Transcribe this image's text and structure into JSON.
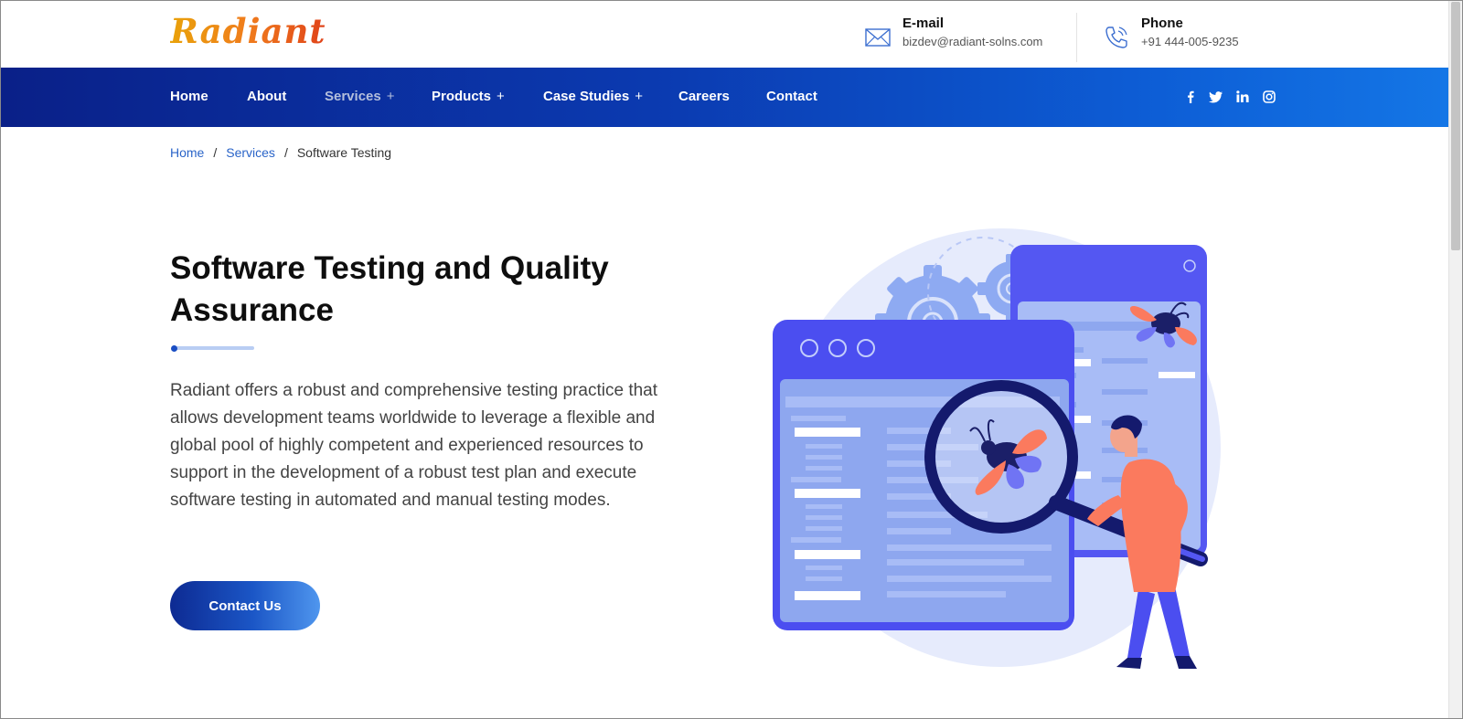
{
  "brand": {
    "logo_text": "Radiant"
  },
  "header_contacts": {
    "email": {
      "label": "E-mail",
      "value": "bizdev@radiant-solns.com",
      "icon": "envelope-icon"
    },
    "phone": {
      "label": "Phone",
      "value": "+91 444-005-9235",
      "icon": "phone-icon"
    }
  },
  "nav": {
    "items": [
      {
        "label": "Home",
        "has_submenu": false
      },
      {
        "label": "About",
        "has_submenu": false
      },
      {
        "label": "Services",
        "has_submenu": true,
        "active": true
      },
      {
        "label": "Products",
        "has_submenu": true
      },
      {
        "label": "Case Studies",
        "has_submenu": true
      },
      {
        "label": "Careers",
        "has_submenu": false
      },
      {
        "label": "Contact",
        "has_submenu": false
      }
    ],
    "submenu_symbol": "+",
    "social": [
      {
        "name": "facebook-icon",
        "glyph": "f"
      },
      {
        "name": "twitter-icon",
        "glyph": "t"
      },
      {
        "name": "linkedin-icon",
        "glyph": "in"
      },
      {
        "name": "instagram-icon",
        "glyph": "ig"
      }
    ]
  },
  "breadcrumb": {
    "home": "Home",
    "services": "Services",
    "current": "Software Testing",
    "separator": "/"
  },
  "hero": {
    "title": "Software Testing and Quality Assurance",
    "description": "Radiant offers a robust and comprehensive testing practice that allows development teams worldwide to leverage a flexible and global pool of highly competent and experienced resources to support in the development of a robust test plan and execute software testing in automated and manual testing modes.",
    "cta_label": "Contact Us"
  },
  "colors": {
    "nav_gradient_start": "#0a2088",
    "nav_gradient_end": "#1476e6",
    "link_blue": "#2a64c8",
    "logo_orange": "#f07c1c",
    "illustration_blue": "#4b4ef0",
    "illustration_coral": "#fb7a5e"
  }
}
